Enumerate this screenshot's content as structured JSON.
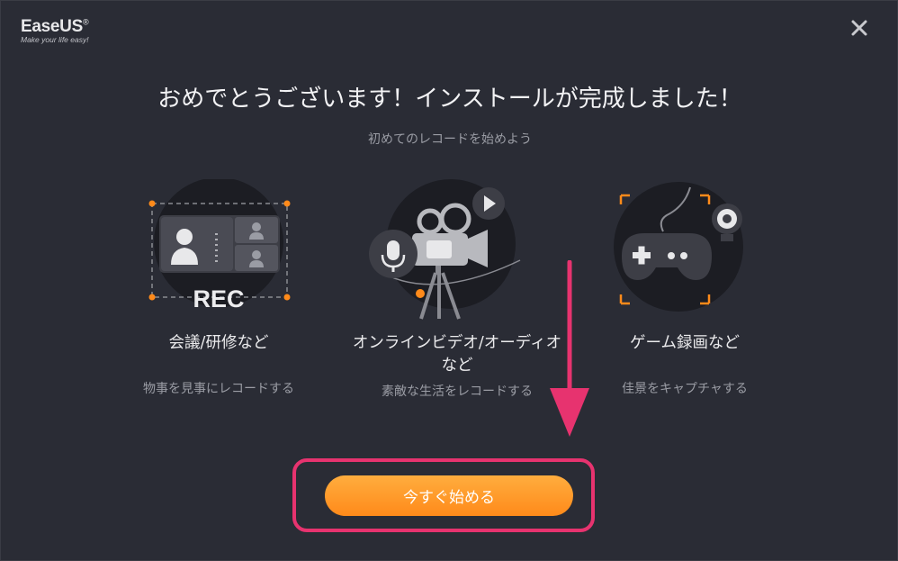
{
  "brand": {
    "name": "EaseUS",
    "reg": "®",
    "tagline": "Make your life easy!"
  },
  "header": {
    "title": "おめでとうございます！インストールが完成しました！",
    "subtitle": "初めてのレコードを始めよう"
  },
  "features": [
    {
      "icon": "meeting-rec-icon",
      "title": "会議/研修など",
      "desc": "物事を見事にレコードする",
      "rec_label": "REC"
    },
    {
      "icon": "video-camera-icon",
      "title_line1": "オンラインビデオ/オーディオ",
      "title_line2": "など",
      "desc": "素敵な生活をレコードする"
    },
    {
      "icon": "game-controller-icon",
      "title": "ゲーム録画など",
      "desc": "佳景をキャプチャする"
    }
  ],
  "cta": {
    "label": "今すぐ始める"
  },
  "colors": {
    "background": "#2a2c35",
    "accent": "#ff9a26",
    "annotation": "#e7336f",
    "corner": "#ff8a1a"
  }
}
